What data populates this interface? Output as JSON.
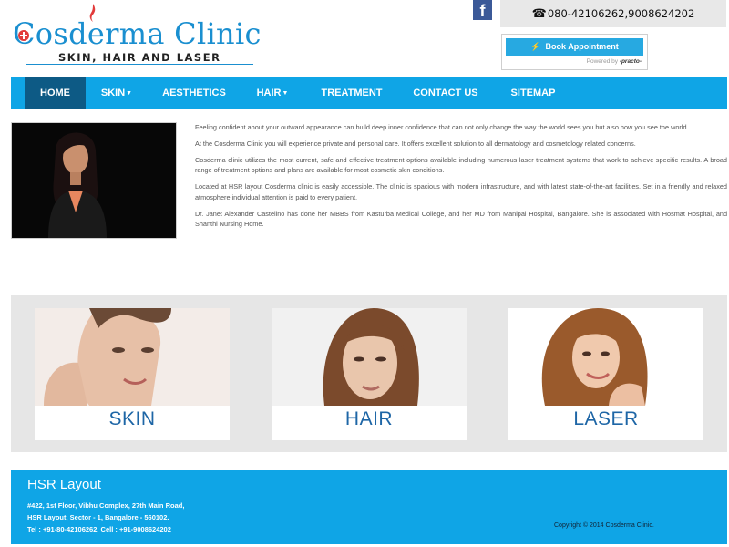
{
  "header": {
    "logo_text": "Cosderma Clinic",
    "logo_tagline": "SKIN, HAIR AND LASER",
    "phone": "080-42106262,9008624202",
    "facebook_label": "f",
    "book_button": "Book Appointment",
    "powered_by_prefix": "Powered by",
    "powered_by_brand": "-practo-"
  },
  "nav": {
    "items": [
      {
        "label": "HOME"
      },
      {
        "label": "SKIN"
      },
      {
        "label": "AESTHETICS"
      },
      {
        "label": "HAIR"
      },
      {
        "label": "TREATMENT"
      },
      {
        "label": "CONTACT US"
      },
      {
        "label": "SITEMAP"
      }
    ]
  },
  "intro": {
    "paragraphs": [
      "Feeling confident about your outward appearance can build deep inner confidence that can not only change the way the world sees you but also how you see the world.",
      "At the Cosderma Clinic you will experience private and personal care. It offers excellent solution to all dermatology and cosmetology related concerns.",
      "Cosderma clinic utilizes the most current, safe and effective treatment options available including numerous laser treatment systems that work to achieve specific results. A broad range of treatment options and plans are available for most cosmetic skin conditions.",
      "Located at HSR layout Cosderma clinic is easily accessible. The clinic is spacious with modern infrastructure, and with latest state-of-the-art facilities. Set in a friendly and relaxed atmosphere individual attention is paid to every patient.",
      "Dr. Janet Alexander Castelino has done her MBBS from Kasturba Medical College, and her MD from Manipal Hospital, Bangalore. She is associated with Hosmat Hospital, and Shanthi Nursing Home."
    ]
  },
  "services": {
    "cards": [
      {
        "label": "SKIN"
      },
      {
        "label": "HAIR"
      },
      {
        "label": "LASER"
      }
    ]
  },
  "footer": {
    "title": "HSR Layout",
    "address_lines": [
      "#422, 1st Floor, Vibhu Complex, 27th Main Road,",
      "HSR Layout, Sector - 1, Bangalore - 560102.",
      "Tel : +91-80-42106262, Cell : +91-9008624202"
    ],
    "copyright": "Copyright © 2014 Cosderma Clinic."
  },
  "colors": {
    "brand_blue": "#0fa5e6",
    "nav_active": "#0d5a85",
    "service_label": "#1e66a6",
    "facebook": "#3b5998"
  },
  "icons": {
    "phone": "phone-icon",
    "facebook": "facebook-icon",
    "book": "lightning-icon"
  }
}
